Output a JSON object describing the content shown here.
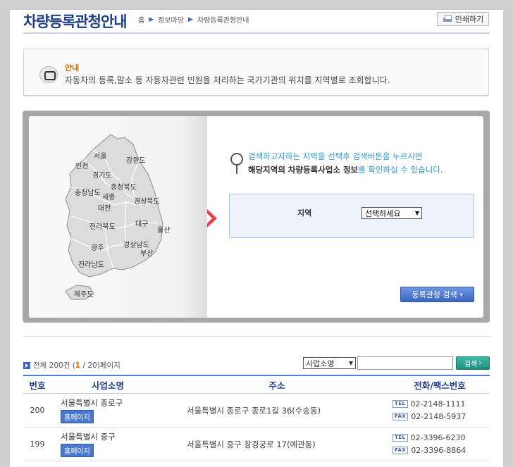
{
  "header": {
    "title": "차량등록관청안내",
    "breadcrumb": [
      "홈",
      "정보마당",
      "차량등록관청안내"
    ],
    "print_label": "인쇄하기"
  },
  "notice": {
    "heading": "안내",
    "text": "자동차의 등록,말소 등 자동차관련 민원을 처리하는 국가기관의 위치를 지역별로 조회합니다."
  },
  "map": {
    "regions": [
      "서울",
      "인천",
      "강원도",
      "경기도",
      "충청북도",
      "충청남도",
      "세종",
      "경상북도",
      "대전",
      "전라북도",
      "대구",
      "울산",
      "광주",
      "경상남도",
      "부산",
      "전라남도",
      "제주도"
    ]
  },
  "guide": {
    "line1": "검색하고자하는 지역을 선택후 검색버튼을 누르시면",
    "line2_bold": "해당지역의 차량등록사업소 정보",
    "line2_rest": "를 확인하실 수 있습니다."
  },
  "region_search": {
    "label": "지역",
    "selected": "선택하세요",
    "button": "등록관청 검색"
  },
  "list": {
    "total_prefix": "전체 200건 (",
    "current_page": "1",
    "total_suffix": " / 20)페이지",
    "field_selected": "사업소명",
    "keyword": "",
    "search_button": "검색",
    "headers": [
      "번호",
      "사업소명",
      "주소",
      "전화/팩스번호"
    ],
    "home_label": "홈페이지",
    "tel_tag": "TEL",
    "fax_tag": "FAX",
    "rows": [
      {
        "num": "200",
        "name": "서울특별시 종로구",
        "address": "서울특별시 종로구 종로1길 36(수송동)",
        "tel": "02-2148-1111",
        "fax": "02-2148-5937"
      },
      {
        "num": "199",
        "name": "서울특별시 중구",
        "address": "서울특별시 중구 창경궁로 17(예관동)",
        "tel": "02-3396-6230",
        "fax": "02-3396-8864"
      }
    ]
  },
  "colors": {
    "title": "#1f3f86",
    "accent_orange": "#e06a00",
    "accent_blue": "#2c9cd6",
    "arrow_red": "#e8414f"
  }
}
